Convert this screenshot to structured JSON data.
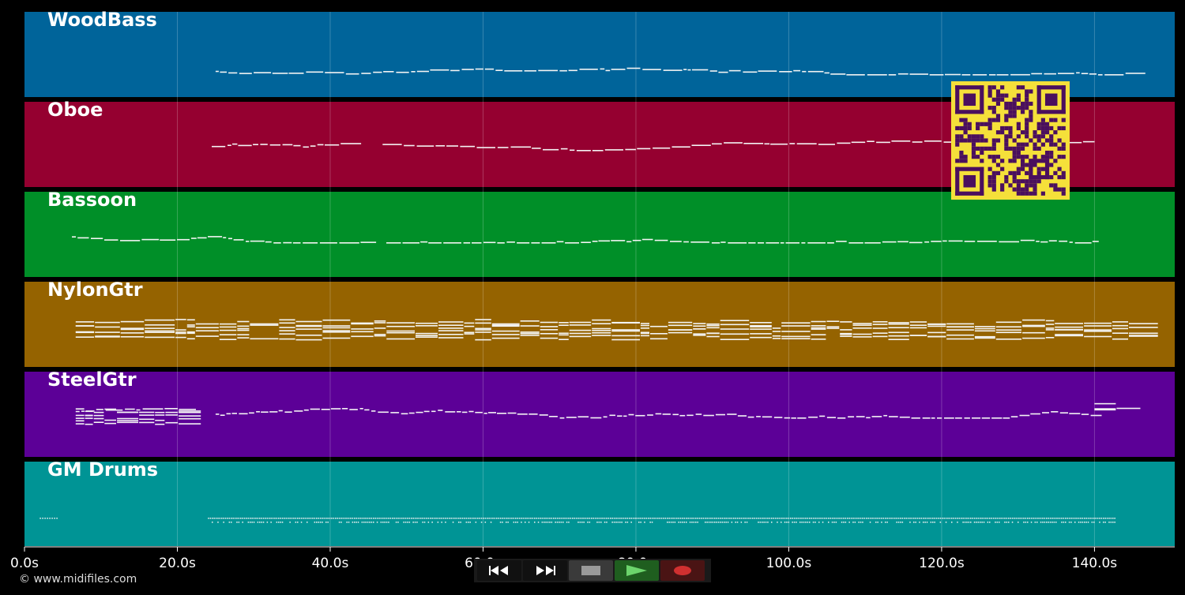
{
  "tracks": [
    {
      "name": "WoodBass",
      "color": "#00649a"
    },
    {
      "name": "Oboe",
      "color": "#950030"
    },
    {
      "name": "Bassoon",
      "color": "#008f28"
    },
    {
      "name": "NylonGtr",
      "color": "#956300"
    },
    {
      "name": "SteelGtr",
      "color": "#5c0097"
    },
    {
      "name": "GM Drums",
      "color": "#009495"
    }
  ],
  "axis": {
    "ticks": [
      {
        "value": 0,
        "label": "0.0s"
      },
      {
        "value": 20,
        "label": "20.0s"
      },
      {
        "value": 40,
        "label": "40.0s"
      },
      {
        "value": 60,
        "label": "60.0s"
      },
      {
        "value": 80,
        "label": "80.0s"
      },
      {
        "value": 100,
        "label": "100.0s"
      },
      {
        "value": 120,
        "label": "120.0s"
      },
      {
        "value": 140,
        "label": "140.0s"
      }
    ],
    "max_seconds": 150.5
  },
  "copyright": "© www.midifiles.com",
  "qr_colors": {
    "fg": "#4a0f5e",
    "bg": "#f5e03a"
  },
  "transport": {
    "buttons": [
      {
        "name": "rewind-button",
        "icon": "rewind-icon",
        "bg": "#111111"
      },
      {
        "name": "fast-forward-button",
        "icon": "fast-forward-icon",
        "bg": "#111111"
      },
      {
        "name": "stop-button",
        "icon": "stop-icon",
        "bg": "#3a3a3a"
      },
      {
        "name": "play-button",
        "icon": "play-icon",
        "bg": "#1f5e1f"
      },
      {
        "name": "record-button",
        "icon": "record-icon",
        "bg": "#4a1414"
      }
    ]
  }
}
